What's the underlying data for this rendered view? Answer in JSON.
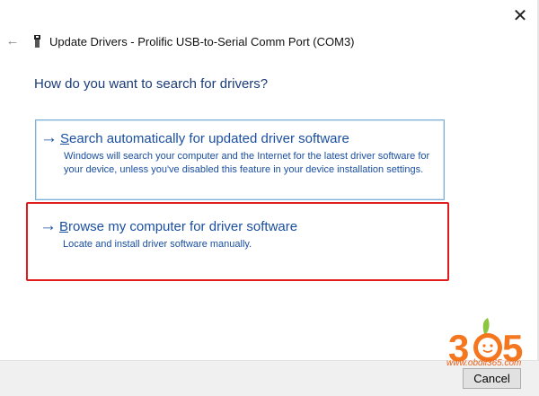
{
  "window": {
    "title": "Update Drivers - Prolific USB-to-Serial Comm Port (COM3)",
    "close_glyph": "✕",
    "back_glyph": "←"
  },
  "prompt": "How do you want to search for drivers?",
  "options": [
    {
      "arrow": "→",
      "title_mnemonic": "S",
      "title_rest": "earch automatically for updated driver software",
      "description": "Windows will search your computer and the Internet for the latest driver software for your device, unless you've disabled this feature in your device installation settings."
    },
    {
      "arrow": "→",
      "title_mnemonic": "B",
      "title_rest": "rowse my computer for driver software",
      "description": "Locate and install driver software manually."
    }
  ],
  "footer": {
    "cancel_label": "Cancel"
  },
  "watermark": {
    "logo_text": "365",
    "url": "www.obdii365.com"
  },
  "colors": {
    "link_blue": "#1a4fa0",
    "heading_blue": "#1a3c78",
    "highlight_red": "#e01c1c",
    "watermark_orange": "#f4761f",
    "watermark_green": "#8cc63f"
  },
  "icons": {
    "back": "back-arrow-icon",
    "close": "close-icon",
    "device": "usb-device-icon",
    "option": "arrow-right-icon"
  }
}
